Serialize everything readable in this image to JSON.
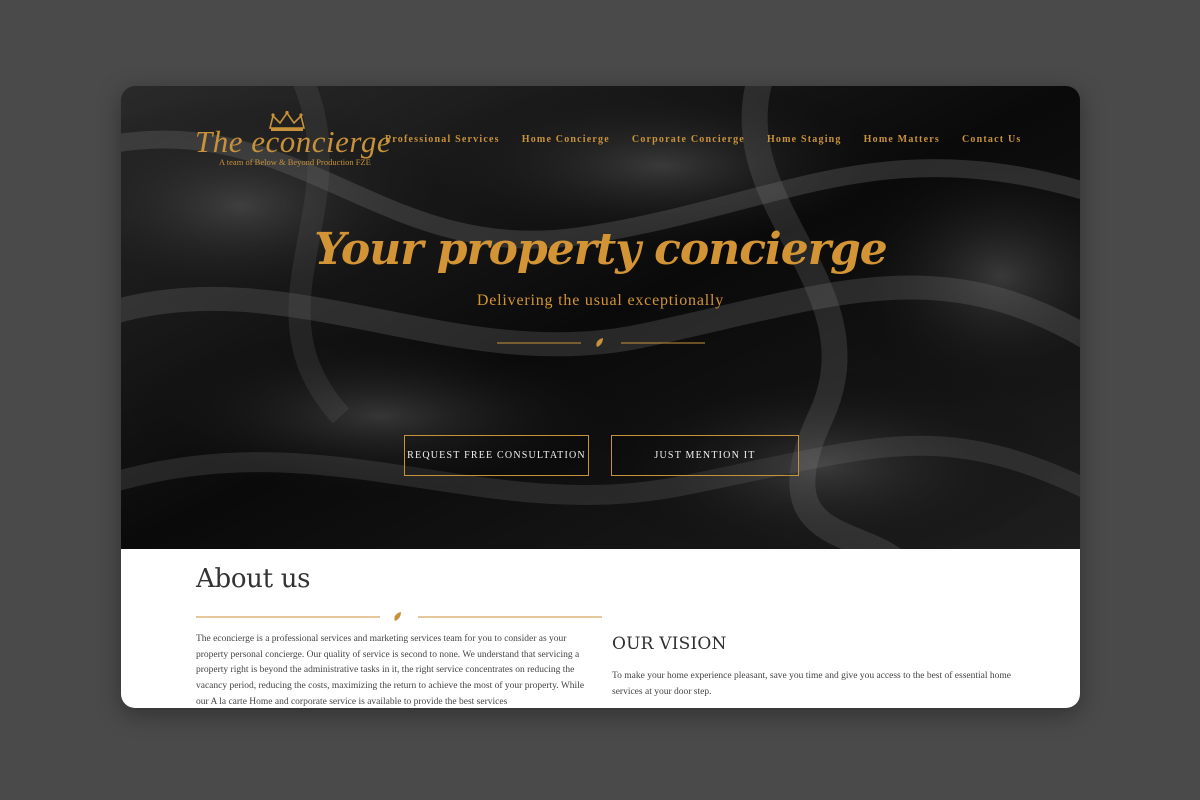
{
  "logo": {
    "title": "The econcierge",
    "tagline": "A team of Below & Beyond Production FZE",
    "crown_icon": "crown-icon"
  },
  "nav": {
    "items": [
      {
        "label": "Professional Services"
      },
      {
        "label": "Home Concierge"
      },
      {
        "label": "Corporate Concierge"
      },
      {
        "label": "Home Staging"
      },
      {
        "label": "Home Matters"
      },
      {
        "label": "Contact Us"
      }
    ]
  },
  "hero": {
    "title": "Your property concierge",
    "subtitle": "Delivering the usual exceptionally",
    "divider_icon": "leaf-icon",
    "buttons": {
      "consult": "REQUEST FREE CONSULTATION",
      "mention": "JUST MENTION IT"
    }
  },
  "about": {
    "title": "About us",
    "body": "The econcierge is a professional services and marketing services team for you to consider as your property personal concierge. Our quality of service is second to none. We understand that servicing a property right is beyond the administrative tasks in it, the right service concentrates on reducing the vacancy period, reducing the costs, maximizing the return to achieve the most of your property. While our A la carte Home and corporate service is available to provide the best services",
    "divider_icon": "leaf-icon"
  },
  "vision": {
    "title": "OUR VISION",
    "body": "To make your home experience pleasant, save you time and give you access to the best of essential home services at your door step."
  },
  "colors": {
    "accent": "#c8923a",
    "hero_bg": "#0b0b0b",
    "page_bg": "#4a4a4a"
  }
}
